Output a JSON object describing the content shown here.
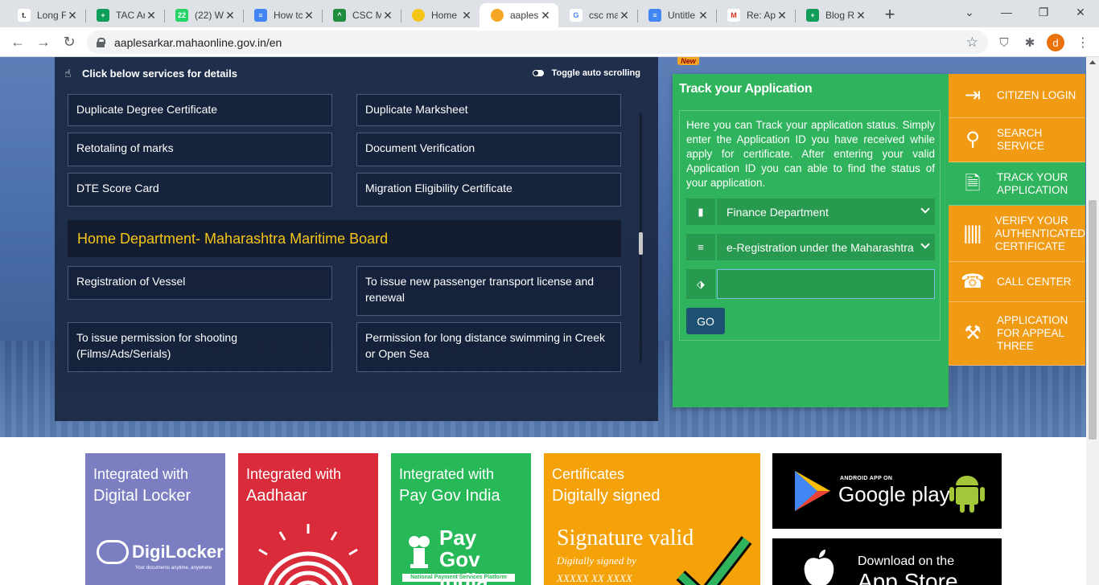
{
  "browser": {
    "tabs": [
      {
        "title": "Long F",
        "favicon_color": "#ffffff",
        "favicon_text": "t.",
        "favicon_fg": "#222222"
      },
      {
        "title": "TAC Ar",
        "favicon_color": "#0f9d58",
        "favicon_text": "+",
        "favicon_fg": "#ffffff"
      },
      {
        "title": "(22) W",
        "favicon_color": "#25d366",
        "favicon_text": "22",
        "favicon_fg": "#ffffff"
      },
      {
        "title": "How tc",
        "favicon_color": "#4285f4",
        "favicon_text": "≡",
        "favicon_fg": "#ffffff"
      },
      {
        "title": "CSC M",
        "favicon_color": "#1e8e3e",
        "favicon_text": "^",
        "favicon_fg": "#ffffff"
      },
      {
        "title": "Home",
        "favicon_color": "#f5c518",
        "favicon_text": "",
        "favicon_fg": "#ffffff"
      },
      {
        "title": "aaples",
        "favicon_color": "#f5a623",
        "favicon_text": "",
        "favicon_fg": "#ffffff",
        "active": true
      },
      {
        "title": "csc ma",
        "favicon_color": "#ffffff",
        "favicon_text": "G",
        "favicon_fg": "#4285f4"
      },
      {
        "title": "Untitle",
        "favicon_color": "#4285f4",
        "favicon_text": "≡",
        "favicon_fg": "#ffffff"
      },
      {
        "title": "Re: Ap",
        "favicon_color": "#ffffff",
        "favicon_text": "M",
        "favicon_fg": "#d93025"
      },
      {
        "title": "Blog R",
        "favicon_color": "#0f9d58",
        "favicon_text": "+",
        "favicon_fg": "#ffffff"
      }
    ],
    "url": "aaplesarkar.mahaonline.gov.in/en",
    "profile_initial": "d"
  },
  "services": {
    "header": "Click below services for details",
    "toggle_label": "Toggle auto scrolling",
    "items_top": [
      {
        "left": "Duplicate Degree Certificate",
        "right": "Duplicate Marksheet"
      },
      {
        "left": "Retotaling of marks",
        "right": "Document Verification"
      },
      {
        "left": "DTE Score Card",
        "right": "Migration Eligibility Certificate"
      }
    ],
    "department": "Home Department- Maharashtra Maritime Board",
    "items_bottom": [
      {
        "left": "Registration of Vessel",
        "right": "To issue new passenger transport license and renewal"
      },
      {
        "left": "To issue permission for shooting (Films/Ads/Serials)",
        "right": "Permission for long distance swimming in Creek or Open Sea"
      }
    ]
  },
  "track": {
    "badge": "New",
    "title": "Track your Application",
    "description": "Here you can Track your application status. Simply enter the Application ID you have received while apply for certificate. After entering your valid Application ID you can able to find the status of your application.",
    "department_select": "Finance Department",
    "service_select": "e-Registration under the Maharashtra",
    "app_id_value": "",
    "go_label": "GO"
  },
  "quick_links": [
    {
      "label": "CITIZEN LOGIN",
      "icon": "login-icon"
    },
    {
      "label": "SEARCH SERVICE",
      "icon": "search-icon"
    },
    {
      "label": "TRACK YOUR APPLICATION",
      "icon": "document-icon"
    },
    {
      "label": "VERIFY YOUR AUTHENTICATED CERTIFICATE",
      "icon": "barcode-icon"
    },
    {
      "label": "CALL CENTER",
      "icon": "phone-icon"
    },
    {
      "label": "APPLICATION FOR APPEAL THREE",
      "icon": "gavel-icon"
    }
  ],
  "cards": {
    "digilocker": {
      "line1": "Integrated with",
      "line2": "Digital Locker",
      "logo": "DigiLocker",
      "tagline": "Your documents anytime, anywhere"
    },
    "aadhaar": {
      "line1": "Integrated with",
      "line2": "Aadhaar"
    },
    "paygov": {
      "line1": "Integrated with",
      "line2": "Pay Gov India",
      "logo_line1": "Pay",
      "logo_line2": "Gov India",
      "band": "National Payment Services Platform"
    },
    "signed": {
      "line1": "Certificates",
      "line2": "Digitally signed",
      "sig_valid": "Signature valid",
      "sig_by": "Digitally signed by",
      "sig_name": "XXXXX XX XXXX"
    }
  },
  "stores": {
    "google_small": "ANDROID APP ON",
    "google_big": "Google play",
    "apple_small": "Download on the",
    "apple_big": "App Store"
  }
}
